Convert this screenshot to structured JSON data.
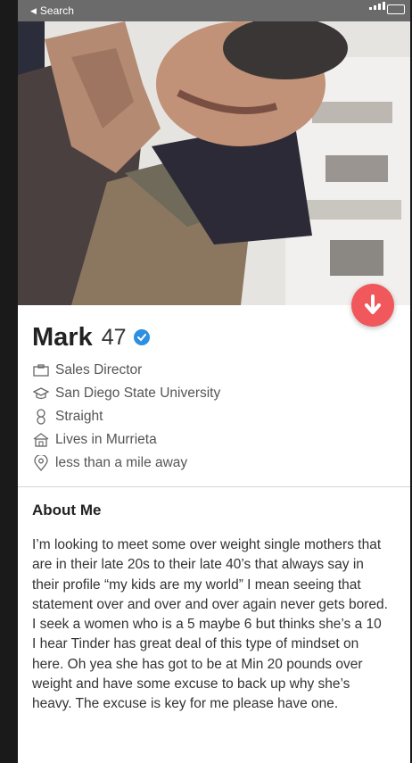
{
  "status_bar": {
    "back_label": "Search"
  },
  "profile": {
    "name": "Mark",
    "age": "47",
    "details": [
      {
        "icon": "briefcase-icon",
        "text": "Sales Director"
      },
      {
        "icon": "graduation-cap-icon",
        "text": "San Diego State University"
      },
      {
        "icon": "gender-icon",
        "text": "Straight"
      },
      {
        "icon": "home-icon",
        "text": "Lives in Murrieta"
      },
      {
        "icon": "location-pin-icon",
        "text": "less than a mile away"
      }
    ]
  },
  "about": {
    "title": "About Me",
    "body": "I’m looking to meet some over weight single mothers that are in their late 20s to their late 40’s that always say in their profile “my kids are my world” I mean seeing that statement over and over and over again never gets bored. I seek a women who is a 5 maybe 6 but thinks she’s a 10 I hear Tinder has great deal of this type of mindset on here. Oh yea she has got to be at Min 20 pounds over weight and have some excuse to back up why she’s heavy. The excuse is key for me please have one."
  },
  "colors": {
    "accent_red": "#f0585b",
    "verified_blue": "#2d8fe0",
    "text_dark": "#222222",
    "text_muted": "#555555"
  }
}
